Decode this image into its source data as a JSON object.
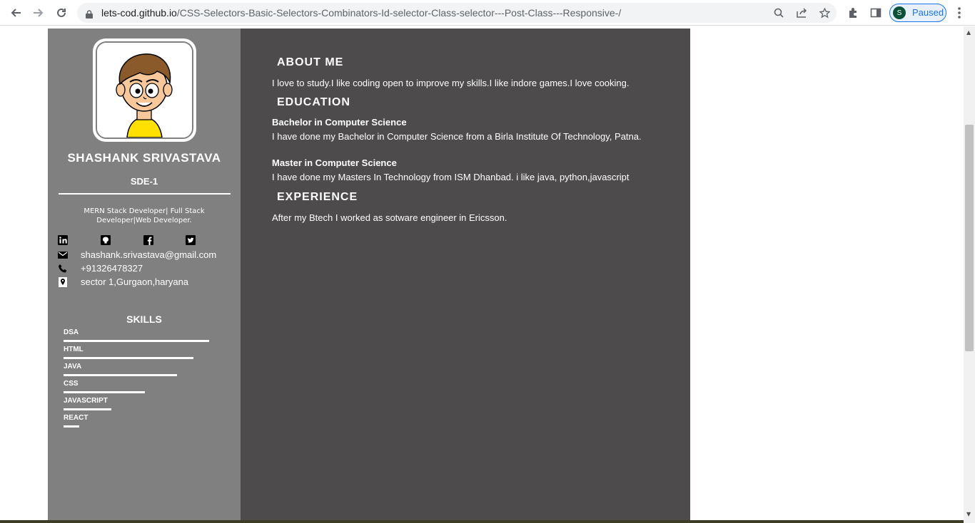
{
  "browser": {
    "url_host": "lets-cod.github.io",
    "url_path": "/CSS-Selectors-Basic-Selectors-Combinators-Id-selector-Class-selector---Post-Class---Responsive-/",
    "profile_initial": "S",
    "profile_status": "Paused"
  },
  "sidebar": {
    "name": "SHASHANK SRIVASTAVA",
    "role": "SDE-1",
    "tagline": "MERN Stack Developer| Full Stack Developer|Web Developer.",
    "contacts": {
      "email": "shashank.srivastava@gmail.com",
      "phone": "+91326478327",
      "address": "sector 1,Gurgaon,haryana"
    },
    "skills_title": "SKILLS",
    "skills": [
      {
        "label": "DSA",
        "level": 1.0
      },
      {
        "label": "HTML",
        "level": 0.89
      },
      {
        "label": "JAVA",
        "level": 0.78
      },
      {
        "label": "CSS",
        "level": 0.56
      },
      {
        "label": "JAVASCRIPT",
        "level": 0.33
      },
      {
        "label": "REACT",
        "level": 0.11
      }
    ]
  },
  "main": {
    "about_title": "ABOUT ME",
    "about_text": "I love to study.I like coding open to improve my skills.I like indore games.I love cooking.",
    "education_title": "EDUCATION",
    "edu1_title": "Bachelor in Computer Science",
    "edu1_text": "I have done my Bachelor in Computer Science from a Birla Institute Of Technology, Patna.",
    "edu2_title": "Master in Computer Science",
    "edu2_text": "I have done my Masters In Technology from ISM Dhanbad. i like java, python,javascript",
    "experience_title": "EXPERIENCE",
    "experience_text": "After my Btech I worked as sotware engineer in Ericsson."
  },
  "colors": {
    "sidebar_bg": "#808080",
    "main_bg": "#4d4b4c"
  },
  "icons": [
    "back-arrow-icon",
    "forward-arrow-icon",
    "reload-icon",
    "lock-icon",
    "zoom-icon",
    "share-icon",
    "star-icon",
    "extensions-icon",
    "side-panel-icon",
    "menu-icon",
    "linkedin-icon",
    "github-icon",
    "facebook-icon",
    "twitter-icon",
    "email-icon",
    "phone-icon",
    "location-icon"
  ]
}
